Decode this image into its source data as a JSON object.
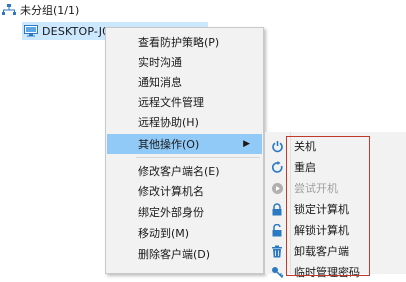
{
  "tree": {
    "group_label": "未分组(1/1)",
    "node_label": "DESKTOP-J0??61"
  },
  "context_menu": {
    "items": [
      {
        "label": "查看防护策略(P)"
      },
      {
        "label": "实时沟通"
      },
      {
        "label": "通知消息"
      },
      {
        "label": "远程文件管理"
      },
      {
        "label": "远程协助(H)"
      },
      {
        "label": "其他操作(O)",
        "submenu_arrow": "▶"
      },
      {
        "label": "修改客户端名(E)"
      },
      {
        "label": "修改计算机名"
      },
      {
        "label": "绑定外部身份"
      },
      {
        "label": "移动到(M)"
      },
      {
        "label": "删除客户端(D)"
      }
    ]
  },
  "submenu": {
    "items": [
      {
        "label": "关机",
        "icon": "power-icon",
        "color": "#2b79c2"
      },
      {
        "label": "重启",
        "icon": "restart-icon",
        "color": "#2b79c2"
      },
      {
        "label": "尝试开机",
        "icon": "play-icon",
        "color": "#b0b0b0",
        "disabled": true
      },
      {
        "label": "锁定计算机",
        "icon": "lock-icon",
        "color": "#2b79c2"
      },
      {
        "label": "解锁计算机",
        "icon": "unlock-icon",
        "color": "#2b79c2"
      },
      {
        "label": "卸载客户端",
        "icon": "trash-icon",
        "color": "#2b79c2"
      },
      {
        "label": "临时管理密码",
        "icon": "key-icon",
        "color": "#2b79c2"
      }
    ]
  },
  "colors": {
    "highlight": "#91c9f7",
    "selection": "#cce8ff",
    "annotation_box": "#c0392b"
  }
}
